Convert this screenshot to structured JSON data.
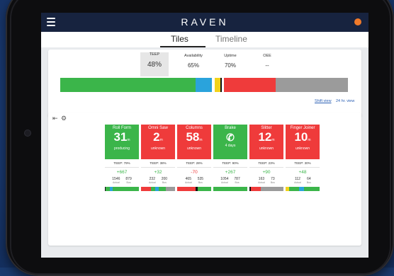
{
  "app": {
    "brand": "RAVEN"
  },
  "tabs": [
    {
      "label": "Tiles",
      "active": true
    },
    {
      "label": "Timeline",
      "active": false
    }
  ],
  "summary": {
    "metrics": [
      {
        "label": "TEEP",
        "value": "48%"
      },
      {
        "label": "Availability",
        "value": "65%"
      },
      {
        "label": "Uptime",
        "value": "70%"
      },
      {
        "label": "OEE",
        "value": "--"
      }
    ],
    "ribbon": [
      {
        "color": "#3bb54a",
        "fraction": 0.47
      },
      {
        "color": "#2aa3dc",
        "fraction": 0.055
      },
      {
        "color": "#ffffff",
        "fraction": 0.01
      },
      {
        "color": "#f2d21a",
        "fraction": 0.02
      },
      {
        "color": "#111111",
        "fraction": 0.005
      },
      {
        "color": "#ffffff",
        "fraction": 0.008
      },
      {
        "color": "#ef3b3b",
        "fraction": 0.18
      },
      {
        "color": "#9b9b9b",
        "fraction": 0.25
      }
    ],
    "shift_link": "Shift view",
    "hours_link": "24 hr. view"
  },
  "colors": {
    "green": "#3bb54a",
    "red": "#ef3b3b",
    "navy": "#17233f",
    "accent": "#f07a2a"
  },
  "machines": [
    {
      "name": "Roll Form",
      "value": "31",
      "unit": "m",
      "state": "producing",
      "color": "#3bb54a",
      "teep": "TEEP: 79%",
      "delta": "+667",
      "delta_color": "#3bb54a",
      "actual": "1546",
      "actual_label": "Actual",
      "bus": "879",
      "bus_label": "Bus",
      "bar": [
        {
          "color": "#111",
          "f": 0.03
        },
        {
          "color": "#3bb54a",
          "f": 0.12
        },
        {
          "color": "#2aa3dc",
          "f": 0.08
        },
        {
          "color": "#3bb54a",
          "f": 0.77
        }
      ]
    },
    {
      "name": "Omni Saw",
      "value": "2",
      "unit": "m",
      "state": "unknown",
      "color": "#ef3b3b",
      "teep": "TEEP: 38%",
      "delta": "+32",
      "delta_color": "#3bb54a",
      "actual": "232",
      "actual_label": "Actual",
      "bus": "200",
      "bus_label": "Bus",
      "bar": [
        {
          "color": "#ef3b3b",
          "f": 0.3
        },
        {
          "color": "#3bb54a",
          "f": 0.12
        },
        {
          "color": "#2aa3dc",
          "f": 0.1
        },
        {
          "color": "#3bb54a",
          "f": 0.2
        },
        {
          "color": "#9b9b9b",
          "f": 0.28
        }
      ]
    },
    {
      "name": "Columns",
      "value": "58",
      "unit": "m",
      "state": "unknown",
      "color": "#ef3b3b",
      "teep": "TEEP: 28%",
      "delta": "-70",
      "delta_color": "#ef3b3b",
      "actual": "465",
      "actual_label": "Actual",
      "bus": "535",
      "bus_label": "Bus",
      "bar": [
        {
          "color": "#ef3b3b",
          "f": 0.55
        },
        {
          "color": "#111",
          "f": 0.05
        },
        {
          "color": "#3bb54a",
          "f": 0.4
        }
      ]
    },
    {
      "name": "Brake",
      "value": "",
      "unit": "",
      "state": "4 days",
      "color": "#3bb54a",
      "icon": true,
      "teep": "TEEP: 90%",
      "delta": "+267",
      "delta_color": "#3bb54a",
      "actual": "1054",
      "actual_label": "Actual",
      "bus": "787",
      "bus_label": "Bus",
      "bar": [
        {
          "color": "#3bb54a",
          "f": 1.0
        }
      ]
    },
    {
      "name": "Slitter",
      "value": "12",
      "unit": "m",
      "state": "unknown",
      "color": "#ef3b3b",
      "teep": "TEEP: 23%",
      "delta": "+90",
      "delta_color": "#3bb54a",
      "actual": "163",
      "actual_label": "Actual",
      "bus": "73",
      "bus_label": "Bus",
      "bar": [
        {
          "color": "#111",
          "f": 0.04
        },
        {
          "color": "#ef3b3b",
          "f": 0.3
        },
        {
          "color": "#9b9b9b",
          "f": 0.66
        }
      ]
    },
    {
      "name": "Finger Joiner",
      "value": "10",
      "unit": "m",
      "state": "unknown",
      "color": "#ef3b3b",
      "teep": "TEEP: 30%",
      "delta": "+48",
      "delta_color": "#3bb54a",
      "actual": "112",
      "actual_label": "Actual",
      "bus": "64",
      "bus_label": "Bus",
      "bar": [
        {
          "color": "#f2d21a",
          "f": 0.1
        },
        {
          "color": "#3bb54a",
          "f": 0.3
        },
        {
          "color": "#2aa3dc",
          "f": 0.15
        },
        {
          "color": "#3bb54a",
          "f": 0.45
        }
      ]
    }
  ]
}
